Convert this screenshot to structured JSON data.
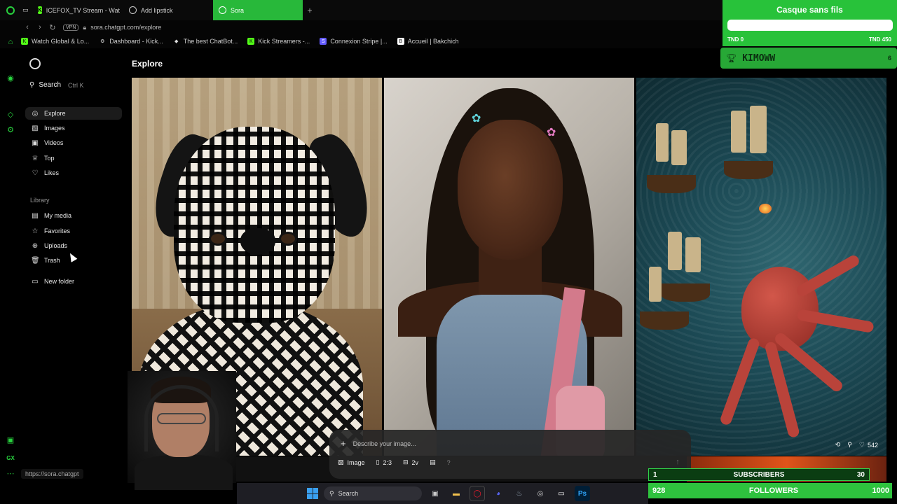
{
  "tabs": [
    {
      "label": "ICEFOX_TV Stream - Wat",
      "favicon": "K"
    },
    {
      "label": "Add lipstick",
      "favicon": "openai-icon"
    },
    {
      "label": "Sora",
      "favicon": "sora-icon",
      "active": true
    }
  ],
  "address": {
    "vpn": "VPN",
    "url": "sora.chatgpt.com/explore"
  },
  "bookmarks": [
    {
      "label": "Watch Global & Lo...",
      "icon": "K"
    },
    {
      "label": "Dashboard - Kick...",
      "icon": "gear-icon"
    },
    {
      "label": "The best ChatBot...",
      "icon": "diamond-icon"
    },
    {
      "label": "Kick Streamers -...",
      "icon": "K"
    },
    {
      "label": "Connexion Stripe |...",
      "icon": "S"
    },
    {
      "label": "Accueil | Bakchich",
      "icon": "B"
    }
  ],
  "sidebar": {
    "search_label": "Search",
    "search_shortcut": "Ctrl K",
    "nav": [
      {
        "label": "Explore",
        "icon": "compass-icon",
        "active": true
      },
      {
        "label": "Images",
        "icon": "image-icon"
      },
      {
        "label": "Videos",
        "icon": "video-icon"
      },
      {
        "label": "Top",
        "icon": "trophy-icon"
      },
      {
        "label": "Likes",
        "icon": "heart-icon"
      }
    ],
    "library_label": "Library",
    "library": [
      {
        "label": "My media",
        "icon": "gallery-icon"
      },
      {
        "label": "Favorites",
        "icon": "star-icon"
      },
      {
        "label": "Uploads",
        "icon": "upload-icon"
      },
      {
        "label": "Trash",
        "icon": "trash-icon"
      }
    ],
    "new_folder": "New folder"
  },
  "main": {
    "title": "Explore",
    "likes": "542"
  },
  "composer": {
    "placeholder": "Describe your image...",
    "type": "Image",
    "ratio": "2:3",
    "variations": "2v",
    "help": "?"
  },
  "status_url": "https://sora.chatgpt",
  "overlay": {
    "goal_title": "Casque sans fils",
    "goal_min": "TND 0",
    "goal_max": "TND 450",
    "goal_progress": 0.0,
    "top_name": "KIMOWW",
    "top_count": "6",
    "sub_current": "1",
    "sub_label": "SUBSCRIBERS",
    "sub_target": "30",
    "fol_current": "928",
    "fol_label": "FOLLOWERS",
    "fol_target": "1000"
  },
  "taskbar": {
    "search": "Search"
  },
  "colors": {
    "accent": "#28c23a",
    "bg": "#000000"
  }
}
